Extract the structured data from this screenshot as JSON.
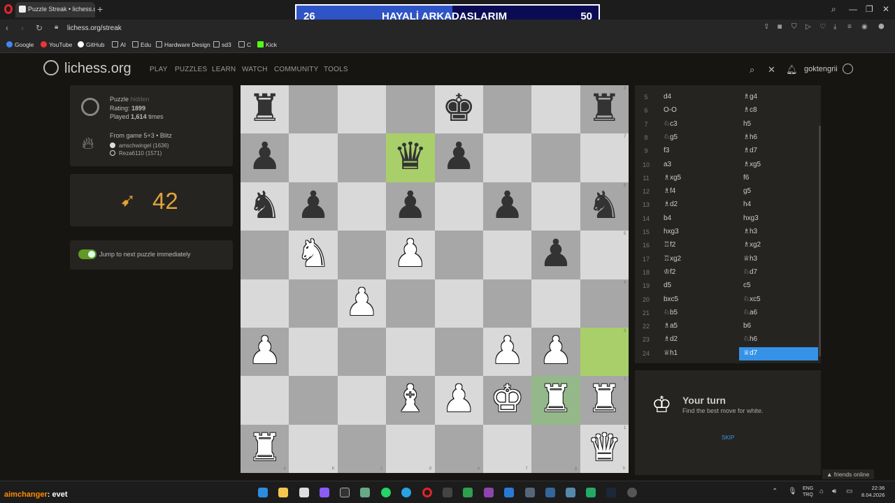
{
  "browser": {
    "tab_title": "Puzzle Streak • lichess.org",
    "url": "lichess.org/streak",
    "bookmarks": [
      "Google",
      "YouTube",
      "GitHub",
      "AI",
      "Edu",
      "Hardware Design",
      "sd3",
      "C",
      "Kick"
    ]
  },
  "banner": {
    "left_score": "26",
    "title": "HAYALİ ARKADAŞLARIM",
    "right_score": "50"
  },
  "header": {
    "logo": "lichess.org",
    "nav": [
      "PLAY",
      "PUZZLES",
      "LEARN",
      "WATCH",
      "COMMUNITY",
      "TOOLS"
    ],
    "username": "goktengrii"
  },
  "puzzle": {
    "label": "Puzzle",
    "hidden": "hidden",
    "rating_label": "Rating:",
    "rating": "1899",
    "played_label": "Played",
    "played": "1,614",
    "played_suffix": "times",
    "from_game": "From game 5+3 • Blitz",
    "white_player": "amschwingel (1636)",
    "black_player": "Reza6110 (1571)"
  },
  "streak": {
    "count": "42"
  },
  "toggle": {
    "label": "Jump to next puzzle immediately"
  },
  "board": {
    "files": [
      "a",
      "b",
      "c",
      "d",
      "e",
      "f",
      "g",
      "h"
    ],
    "ranks": [
      "8",
      "7",
      "6",
      "5",
      "4",
      "3",
      "2",
      "1"
    ],
    "pieces": [
      {
        "sq": "a8",
        "p": "♜",
        "c": "b"
      },
      {
        "sq": "e8",
        "p": "♚",
        "c": "b"
      },
      {
        "sq": "h8",
        "p": "♜",
        "c": "b"
      },
      {
        "sq": "a7",
        "p": "♟",
        "c": "b"
      },
      {
        "sq": "d7",
        "p": "♛",
        "c": "b"
      },
      {
        "sq": "e7",
        "p": "♟",
        "c": "b"
      },
      {
        "sq": "a6",
        "p": "♞",
        "c": "b"
      },
      {
        "sq": "b6",
        "p": "♟",
        "c": "b"
      },
      {
        "sq": "d6",
        "p": "♟",
        "c": "b"
      },
      {
        "sq": "f6",
        "p": "♟",
        "c": "b"
      },
      {
        "sq": "h6",
        "p": "♞",
        "c": "b"
      },
      {
        "sq": "b5",
        "p": "♞",
        "c": "w"
      },
      {
        "sq": "d5",
        "p": "♟",
        "c": "w"
      },
      {
        "sq": "g5",
        "p": "♟",
        "c": "b"
      },
      {
        "sq": "c4",
        "p": "♟",
        "c": "w"
      },
      {
        "sq": "a3",
        "p": "♟",
        "c": "w"
      },
      {
        "sq": "f3",
        "p": "♟",
        "c": "w"
      },
      {
        "sq": "g3",
        "p": "♟",
        "c": "w"
      },
      {
        "sq": "d2",
        "p": "♝",
        "c": "w"
      },
      {
        "sq": "e2",
        "p": "♟",
        "c": "w"
      },
      {
        "sq": "f2",
        "p": "♚",
        "c": "w"
      },
      {
        "sq": "g2",
        "p": "♜",
        "c": "w"
      },
      {
        "sq": "h2",
        "p": "♜",
        "c": "w"
      },
      {
        "sq": "a1",
        "p": "♜",
        "c": "w"
      },
      {
        "sq": "h1",
        "p": "♛",
        "c": "w"
      }
    ],
    "highlight_light": [
      "d7",
      "h3"
    ],
    "highlight_dim": [
      "g2"
    ]
  },
  "moves": [
    {
      "n": "5",
      "w": "d4",
      "b": "♗g4"
    },
    {
      "n": "6",
      "w": "O-O",
      "b": "♗c8"
    },
    {
      "n": "7",
      "w": "♘c3",
      "b": "h5"
    },
    {
      "n": "8",
      "w": "♘g5",
      "b": "♗h6"
    },
    {
      "n": "9",
      "w": "f3",
      "b": "♗d7"
    },
    {
      "n": "10",
      "w": "a3",
      "b": "♗xg5"
    },
    {
      "n": "11",
      "w": "♗xg5",
      "b": "f6"
    },
    {
      "n": "12",
      "w": "♗f4",
      "b": "g5"
    },
    {
      "n": "13",
      "w": "♗d2",
      "b": "h4"
    },
    {
      "n": "14",
      "w": "b4",
      "b": "hxg3"
    },
    {
      "n": "15",
      "w": "hxg3",
      "b": "♗h3"
    },
    {
      "n": "16",
      "w": "♖f2",
      "b": "♗xg2"
    },
    {
      "n": "17",
      "w": "♖xg2",
      "b": "♕h3"
    },
    {
      "n": "18",
      "w": "♔f2",
      "b": "♘d7"
    },
    {
      "n": "19",
      "w": "d5",
      "b": "c5"
    },
    {
      "n": "20",
      "w": "bxc5",
      "b": "♘xc5"
    },
    {
      "n": "21",
      "w": "♘b5",
      "b": "♘a6"
    },
    {
      "n": "22",
      "w": "♗a5",
      "b": "b6"
    },
    {
      "n": "23",
      "w": "♗d2",
      "b": "♘h6"
    },
    {
      "n": "24",
      "w": "♕h1",
      "b": "♕d7"
    }
  ],
  "turn": {
    "title": "Your turn",
    "subtitle": "Find the best move for white.",
    "skip": "SKIP"
  },
  "footer": {
    "friends": "friends online",
    "chat_user": "aimchanger",
    "chat_msg": ": evet",
    "lang1": "ENG",
    "lang2": "TRQ",
    "time": "22:36",
    "date": "8.04.2026"
  }
}
